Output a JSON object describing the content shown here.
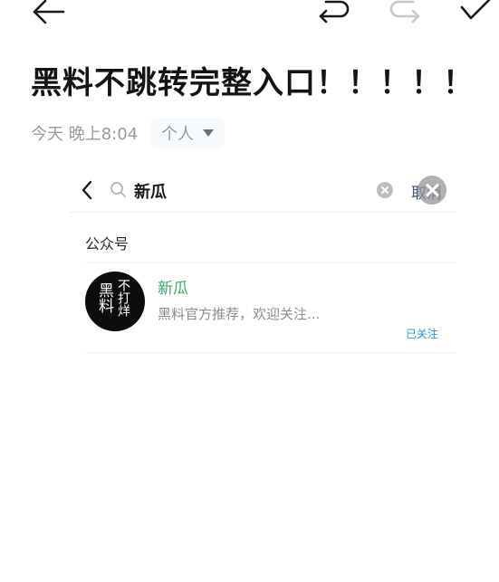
{
  "email": {
    "subject": "黑料不跳转完整入口！！！！！",
    "date": "今天 晚上8:04",
    "folder": "个人"
  },
  "embedded_screenshot": {
    "search_query": "新瓜",
    "cancel_label": "取消",
    "section_label": "公众号",
    "account": {
      "name": "新瓜",
      "description": "黑料官方推荐，欢迎关注...",
      "status": "已关注",
      "avatar_text_left": "黑料",
      "avatar_text_right": "不打烊"
    }
  },
  "colors": {
    "account_name": "#3ba86a",
    "status": "#2f8fd8",
    "avatar_bg": "#0d0d0d",
    "meta_text": "#9a9a9a"
  },
  "icons": [
    "back-arrow-icon",
    "undo-icon",
    "redo-icon",
    "check-icon",
    "chevron-left-icon",
    "search-icon",
    "clear-icon",
    "close-icon",
    "dropdown-caret-icon"
  ]
}
